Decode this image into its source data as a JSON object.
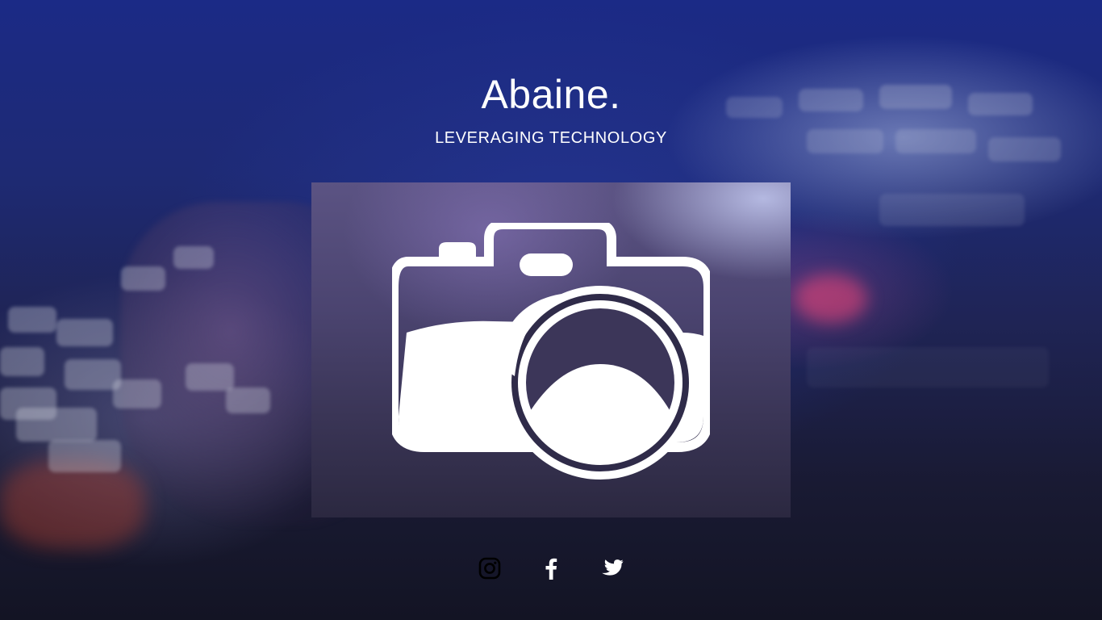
{
  "brand": {
    "title": "Abaine.",
    "tagline": "LEVERAGING TECHNOLOGY"
  },
  "hero_image": {
    "icon": "camera-icon"
  },
  "social": [
    {
      "name": "instagram",
      "icon": "instagram-icon",
      "color": "#000000"
    },
    {
      "name": "facebook",
      "icon": "facebook-icon",
      "color": "#ffffff"
    },
    {
      "name": "twitter",
      "icon": "twitter-icon",
      "color": "#ffffff"
    }
  ],
  "colors": {
    "text": "#ffffff",
    "background_top": "#1b2a86",
    "background_bottom": "#131424"
  }
}
